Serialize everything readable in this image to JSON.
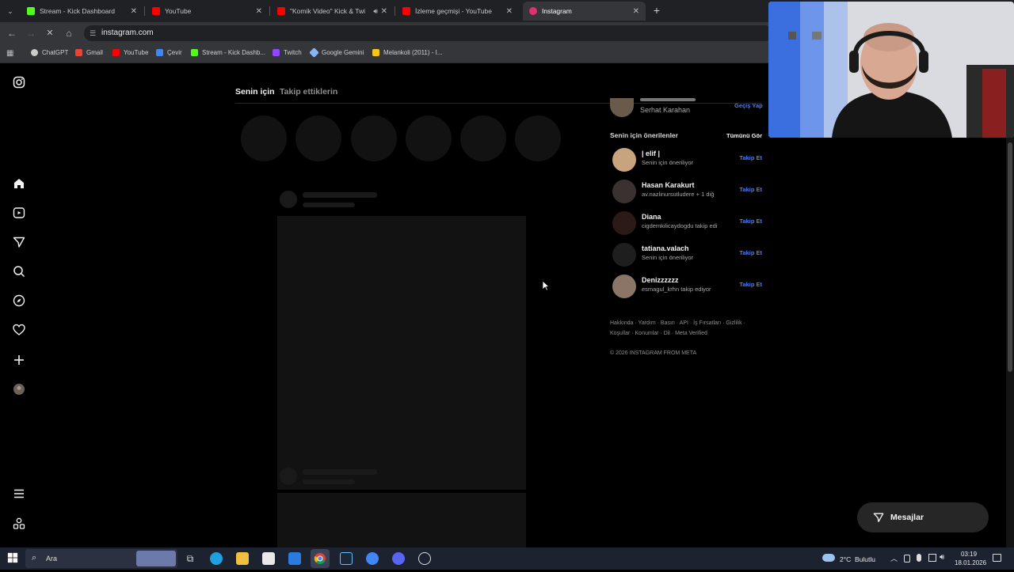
{
  "browser": {
    "tabs": [
      {
        "title": "Stream - Kick Dashboard",
        "favicon_color": "#53fc18"
      },
      {
        "title": "YouTube",
        "favicon_color": "#ff0000"
      },
      {
        "title": "\"Komik Video\" Kick & Twitc",
        "favicon_color": "#ff0000"
      },
      {
        "title": "İzleme geçmişi - YouTube",
        "favicon_color": "#ff0000"
      },
      {
        "title": "Instagram",
        "favicon_color": "#e1306c"
      }
    ],
    "new_tab_icon": "plus-icon",
    "url": "instagram.com",
    "bookmarks": [
      {
        "label": "ChatGPT",
        "color": "#cccccc"
      },
      {
        "label": "Gmail",
        "color": "#ea4335"
      },
      {
        "label": "YouTube",
        "color": "#ff0000"
      },
      {
        "label": "Çevir",
        "color": "#4285f4"
      },
      {
        "label": "Stream - Kick Dashb...",
        "color": "#53fc18"
      },
      {
        "label": "Twitch",
        "color": "#9146ff"
      },
      {
        "label": "Google Gemini",
        "color": "#8ab4f8"
      },
      {
        "label": "Melankoli (2011) - I...",
        "color": "#f5c518"
      }
    ]
  },
  "instagram": {
    "feed_tabs": [
      "Senin için",
      "Takip ettiklerin"
    ],
    "current_user": {
      "display_name": "Serhat Karahan",
      "switch_label": "Geçiş Yap"
    },
    "suggestions_title": "Senin için önerilenler",
    "see_all_label": "Tümünü Gör",
    "suggestions": [
      {
        "name": "| elif |",
        "sub": "Senin için öneriliyor",
        "follow": "Takip Et",
        "avatar_color": "#c9a27e"
      },
      {
        "name": "Hasan Karakurt",
        "sub": "av.nazlinursutludere + 1 diğ",
        "follow": "Takip Et",
        "avatar_color": "#3a3230"
      },
      {
        "name": "Diana",
        "sub": "cigdemkilicaydogdu takip edi",
        "follow": "Takip Et",
        "avatar_color": "#2c1a16"
      },
      {
        "name": "tatiana.valach",
        "sub": "Senin için öneriliyor",
        "follow": "Takip Et",
        "avatar_color": "#1e1e1e"
      },
      {
        "name": "Denizzzzzz",
        "sub": "esmagul_krhn takip ediyor",
        "follow": "Takip Et",
        "avatar_color": "#8a7566"
      }
    ],
    "footer_links_line1": "Hakkında · Yardım · Basın · API · İş Fırsatları · Gizlilik ·",
    "footer_links_line2": "Koşullar · Konumlar · Dil · Meta Verified",
    "copyright": "© 2026 INSTAGRAM FROM META",
    "messages_label": "Mesajlar"
  },
  "taskbar": {
    "search_placeholder": "Ara",
    "weather": "2°C  Bulutlu",
    "time": "03:19",
    "date": "18.01.2026"
  }
}
